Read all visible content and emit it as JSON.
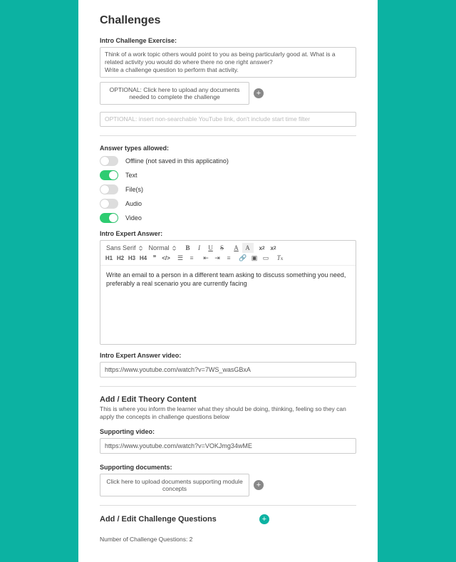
{
  "title": "Challenges",
  "intro": {
    "label": "Intro Challenge Exercise:",
    "text": "Think of a work topic others would point to you as being particularly good at. What is a related activity you would do where there no one right answer?\nWrite a challenge question to perform that activity.",
    "upload": "OPTIONAL: Click here to upload any documents needed to complete the challenge",
    "youtube_placeholder": "OPTIONAL: insert non-searchable YouTube link, don't include start time filter"
  },
  "answerTypes": {
    "label": "Answer types allowed:",
    "items": [
      {
        "label": "Offline (not saved in this applicatino)",
        "on": false
      },
      {
        "label": "Text",
        "on": true
      },
      {
        "label": "File(s)",
        "on": false
      },
      {
        "label": "Audio",
        "on": false
      },
      {
        "label": "Video",
        "on": true
      }
    ]
  },
  "expertAnswer": {
    "label": "Intro Expert Answer:",
    "font": "Sans Serif",
    "style": "Normal",
    "h": [
      "H1",
      "H2",
      "H3",
      "H4"
    ],
    "content": "Write an email to a person in a different team asking to discuss something you need, preferably a real scenario you are currently facing",
    "video_label": "Intro Expert Answer video:",
    "video_value": "https://www.youtube.com/watch?v=7WS_wasGBxA"
  },
  "theory": {
    "title": "Add / Edit Theory Content",
    "desc": "This is where you inform the learner what they should be doing, thinking, feeling so they can apply the concepts in challenge questions below",
    "video_label": "Supporting video:",
    "video_value": "https://www.youtube.com/watch?v=VOKJmg34wME",
    "docs_label": "Supporting documents:",
    "docs_upload": "Click here to upload documents supporting module concepts"
  },
  "questions": {
    "title": "Add / Edit Challenge Questions",
    "count_label": "Number of Challenge Questions: 2"
  }
}
